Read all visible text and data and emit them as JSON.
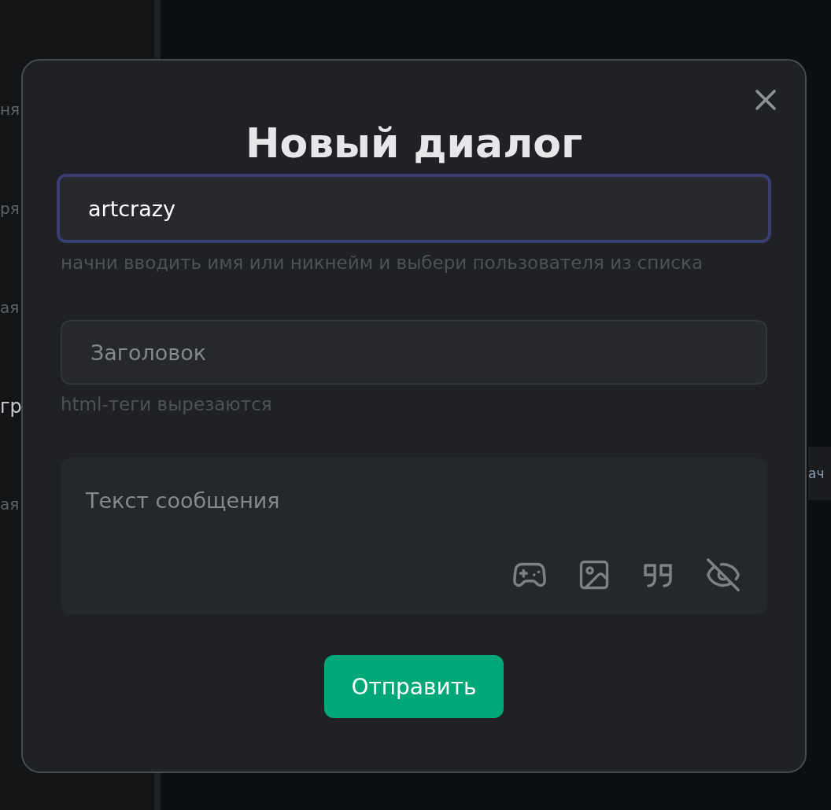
{
  "background": {
    "sidebar_fragments": [
      {
        "text": "ня",
        "kind": "muted"
      },
      {
        "text": "ря",
        "kind": "muted"
      },
      {
        "text": "ая",
        "kind": "muted"
      },
      {
        "text": "гр",
        "kind": "title"
      },
      {
        "text": "ая",
        "kind": "muted"
      }
    ],
    "content_fragment": "ач"
  },
  "dialog": {
    "title": "Новый диалог",
    "recipient": {
      "value": "artcrazy",
      "focused": true,
      "hint": "начни вводить имя или никнейм и выбери пользователя из списка"
    },
    "subject": {
      "placeholder": "Заголовок",
      "focused": false,
      "hint": "html-теги вырезаются"
    },
    "message": {
      "placeholder": "Текст сообщения"
    },
    "submit": "Отправить"
  }
}
